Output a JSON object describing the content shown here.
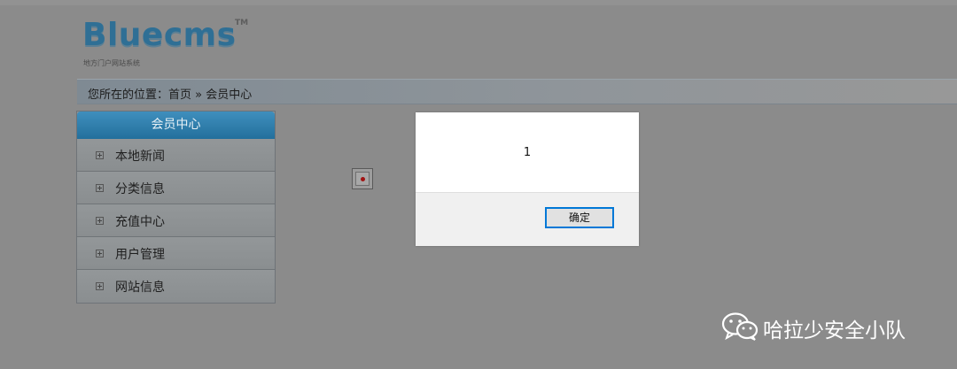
{
  "logo": {
    "brand": "Bluecms",
    "trademark": "TM",
    "tagline": "地方门户网站系统"
  },
  "breadcrumb": {
    "text": "您所在的位置：首页 » 会员中心"
  },
  "sidebar": {
    "title": "会员中心",
    "items": [
      {
        "label": "本地新闻",
        "icon": "plus-box-icon"
      },
      {
        "label": "分类信息",
        "icon": "plus-box-icon"
      },
      {
        "label": "充值中心",
        "icon": "plus-box-icon"
      },
      {
        "label": "用户管理",
        "icon": "plus-box-icon"
      },
      {
        "label": "网站信息",
        "icon": "plus-box-icon"
      }
    ]
  },
  "content": {
    "image_icon": "broken-image-icon"
  },
  "alert": {
    "message": "1",
    "ok_label": "确定"
  },
  "watermark": {
    "icon": "wechat-icon",
    "text": "哈拉少安全小队"
  },
  "colors": {
    "overlay": "#8b8b8b",
    "sidebar_header": "#2a77a4",
    "logo": "#2f6f95",
    "dialog_button_border": "#0078d7"
  }
}
